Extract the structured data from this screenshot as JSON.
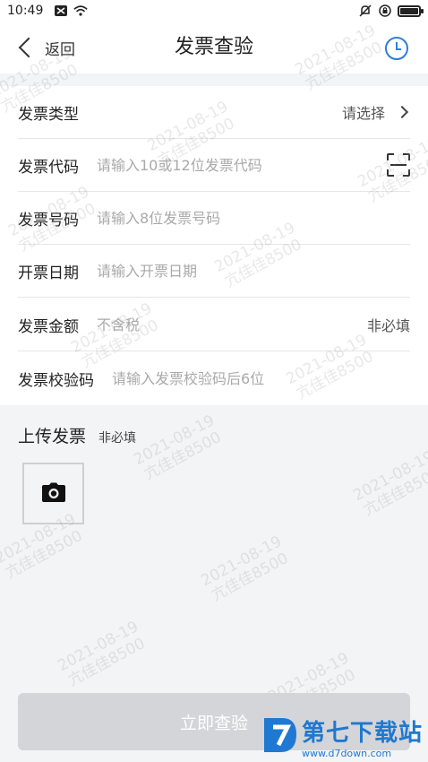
{
  "status_bar": {
    "time": "10:49"
  },
  "nav": {
    "back_label": "返回",
    "title": "发票查验"
  },
  "form": {
    "invoice_type": {
      "label": "发票类型",
      "value": "请选择"
    },
    "invoice_code": {
      "label": "发票代码",
      "placeholder": "请输入10或12位发票代码"
    },
    "invoice_number": {
      "label": "发票号码",
      "placeholder": "请输入8位发票号码"
    },
    "invoice_date": {
      "label": "开票日期",
      "placeholder": "请输入开票日期"
    },
    "invoice_amount": {
      "label": "发票金额",
      "placeholder": "不含税",
      "hint": "非必填"
    },
    "check_code": {
      "label": "发票校验码",
      "placeholder": "请输入发票校验码后6位"
    }
  },
  "upload": {
    "title": "上传发票",
    "hint": "非必填"
  },
  "submit_label": "立即查验",
  "watermark": {
    "line1": "2021-08-19",
    "line2": "亢佳佳8500"
  },
  "site_logo": {
    "name": "第七下载站",
    "url": "www.d7down.com"
  },
  "colors": {
    "accent": "#2f7de1",
    "button_disabled": "#d4d5d8",
    "logo": "#1f78d1"
  }
}
